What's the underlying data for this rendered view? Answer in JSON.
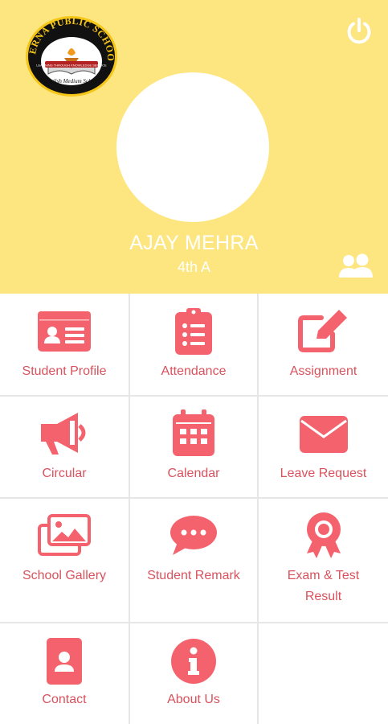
{
  "header": {
    "logo": {
      "top_text": "PRERNA PUBLIC SCHOOL",
      "ribbon_text": "LEARNING THROUGH KNOWLEDGE SERVICE",
      "bottom_text": "English Medium School"
    },
    "student_name": "AJAY MEHRA",
    "student_class": "4th A"
  },
  "colors": {
    "header_bg": "#fde67f",
    "icon": "#f4636d",
    "label": "#d9525d",
    "divider": "#e6e6e6"
  },
  "menu": [
    {
      "label": "Student Profile",
      "icon": "id-card-icon"
    },
    {
      "label": "Attendance",
      "icon": "clipboard-list-icon"
    },
    {
      "label": "Assignment",
      "icon": "edit-icon"
    },
    {
      "label": "Circular",
      "icon": "megaphone-icon"
    },
    {
      "label": "Calendar",
      "icon": "calendar-icon"
    },
    {
      "label": "Leave Request",
      "icon": "envelope-icon"
    },
    {
      "label": "School Gallery",
      "icon": "images-icon"
    },
    {
      "label": "Student Remark",
      "icon": "chat-bubble-icon"
    },
    {
      "label_line1": "Exam & Test",
      "label_line2": "Result",
      "icon": "award-icon"
    },
    {
      "label": "Contact",
      "icon": "contact-card-icon"
    },
    {
      "label": "About Us",
      "icon": "info-icon"
    }
  ]
}
